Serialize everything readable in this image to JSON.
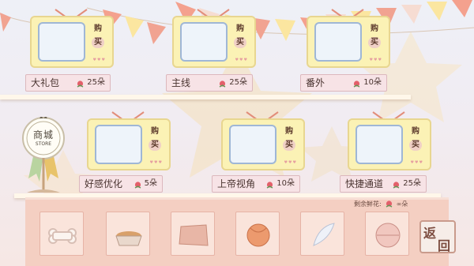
{
  "store_badge": {
    "label_line1": "商城",
    "label_line2": "STORE"
  },
  "items": [
    {
      "name": "大礼包",
      "price": "25朵",
      "buy_top": "购",
      "buy_bottom": "买"
    },
    {
      "name": "主线",
      "price": "25朵",
      "buy_top": "购",
      "buy_bottom": "买"
    },
    {
      "name": "番外",
      "price": "10朵",
      "buy_top": "购",
      "buy_bottom": "买"
    },
    {
      "name": "好感优化",
      "price": "5朵",
      "buy_top": "购",
      "buy_bottom": "买"
    },
    {
      "name": "上帝视角",
      "price": "10朵",
      "buy_top": "购",
      "buy_bottom": "买"
    },
    {
      "name": "快捷通道",
      "price": "25朵",
      "buy_top": "购",
      "buy_bottom": "买"
    }
  ],
  "remaining": {
    "label": "剩余鲜花:",
    "value": "∞朵"
  },
  "back_button": {
    "char1": "返",
    "char2": "回"
  },
  "colors": {
    "accent": "#f0a090",
    "tv_body": "#fbf2b5",
    "screen": "#eef4fa",
    "plate": "#f7e3e6"
  },
  "inventory_icons": [
    "bone-icon",
    "food-bowl-icon",
    "cushion-icon",
    "ball-icon",
    "feather-icon",
    "frisbee-icon"
  ]
}
